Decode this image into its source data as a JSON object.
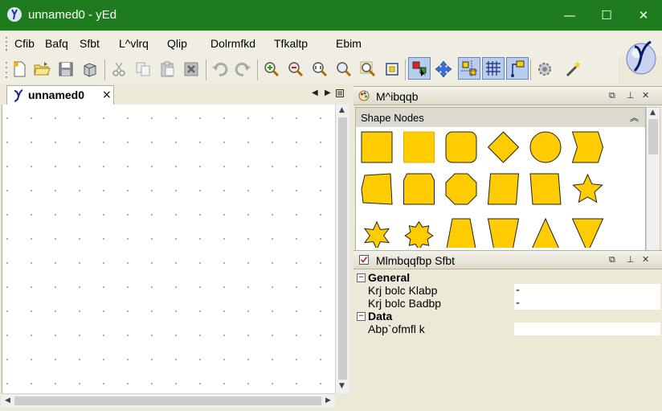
{
  "window": {
    "title": "unnamed0 - yEd",
    "minimize_glyph": "—",
    "maximize_glyph": "☐",
    "close_glyph": "✕"
  },
  "menubar": {
    "items": [
      {
        "label": "Cfib"
      },
      {
        "label": "Bafq"
      },
      {
        "label": "Sfbt"
      },
      {
        "label": "L^vlrq"
      },
      {
        "label": "Qlip"
      },
      {
        "label": "Dolrmfkd"
      },
      {
        "label": "Tfkaltp"
      },
      {
        "label": "Ebim"
      }
    ]
  },
  "toolbar": {
    "icons": [
      "new-document-icon",
      "open-folder-icon",
      "save-icon",
      "save-as-icon",
      "cut-icon",
      "copy-icon",
      "paste-icon",
      "delete-icon",
      "undo-icon",
      "redo-icon",
      "zoom-in-icon",
      "zoom-out-icon",
      "zoom-actual-size-icon",
      "zoom-fit-icon",
      "zoom-area-icon",
      "fit-content-icon",
      "edit-mode-icon",
      "navigation-mode-icon",
      "snap-to-node-icon",
      "grid-icon",
      "orthogonal-edges-icon",
      "settings-icon",
      "magic-wand-icon"
    ]
  },
  "document": {
    "tab_label": "unnamed0",
    "tab_close": "×"
  },
  "palette": {
    "title": "M^ibqqb",
    "section": "Shape Nodes",
    "collapse_glyph": "⌃",
    "shapes": [
      "rectangle",
      "rectangle-raised",
      "rounded-rectangle",
      "diamond",
      "ellipse",
      "hexagon-arrow",
      "trapezoid-curved",
      "fat-arrow-rounded",
      "octagon",
      "parallelogram-left",
      "parallelogram-right",
      "star-5",
      "star-6",
      "star-8",
      "trapezoid",
      "trapezoid-inverted",
      "triangle",
      "triangle-inverted"
    ]
  },
  "properties": {
    "title": "Mlmbqqfbp Sfbt",
    "groups": [
      {
        "name": "General",
        "rows": [
          {
            "name": "Krj bolc Klabp",
            "value": "-"
          },
          {
            "name": "Krj bolc Badbp",
            "value": "-"
          }
        ]
      },
      {
        "name": "Data",
        "rows": [
          {
            "name": "Abp`ofmfl k",
            "value": ""
          }
        ]
      }
    ]
  },
  "colors": {
    "titlebar": "#1e7c1e",
    "shape_fill": "#ffcc00",
    "shape_stroke": "#222222"
  }
}
